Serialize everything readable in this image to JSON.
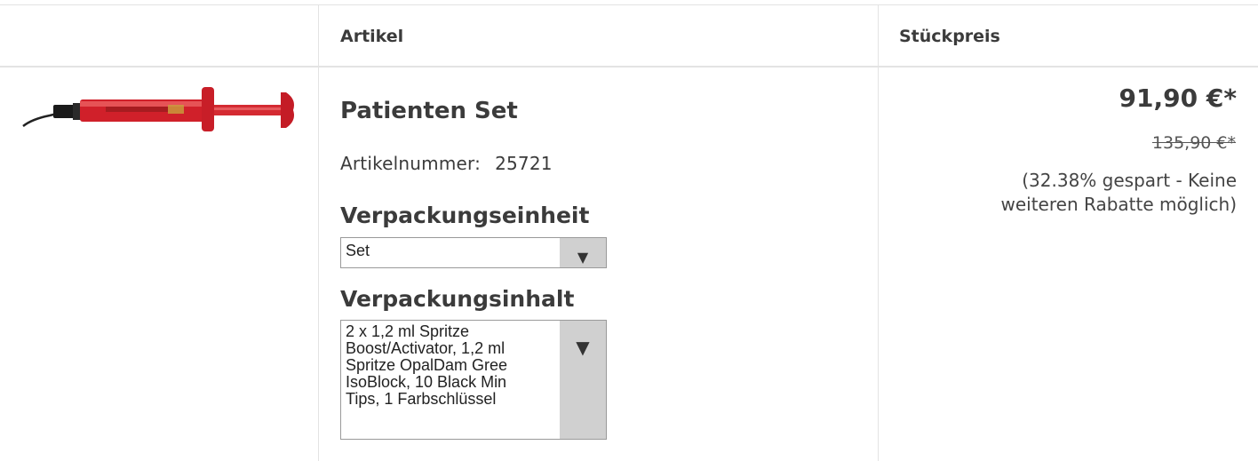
{
  "header": {
    "article_label": "Artikel",
    "unit_price_label": "Stückpreis"
  },
  "product": {
    "image_icon": "syringe-product-image",
    "name": "Patienten Set",
    "article_number_label": "Artikelnummer:",
    "article_number": "25721",
    "packaging_unit_label": "Verpackungseinheit",
    "packaging_unit_value": "Set",
    "packaging_content_label": "Verpackungsinhalt",
    "packaging_content_lines": [
      "2 x 1,2 ml Spritze",
      "Boost/Activator, 1,2 ml",
      "Spritze OpalDam Gree",
      "IsoBlock, 10 Black Min",
      "Tips, 1 Farbschlüssel"
    ]
  },
  "pricing": {
    "price": "91,90 €*",
    "old_price": "135,90 €*",
    "savings_note_line1": "(32.38% gespart - Keine",
    "savings_note_line2": "weiteren Rabatte möglich)"
  },
  "icons": {
    "dropdown_arrow": "▼"
  }
}
